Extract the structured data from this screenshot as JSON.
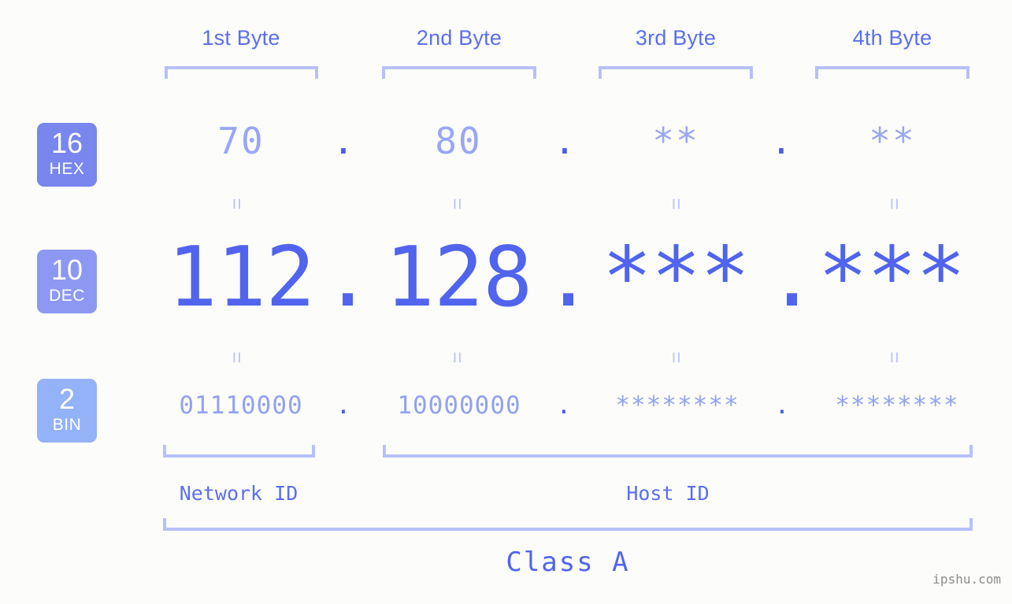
{
  "meta": {
    "watermark": "ipshu.com",
    "background_color": "#fcfdfa",
    "accent_color": "#5064ee",
    "accent_light_color": "#b8c0fb"
  },
  "headers": {
    "bytes": [
      {
        "label": "1st Byte"
      },
      {
        "label": "2nd Byte"
      },
      {
        "label": "3rd Byte"
      },
      {
        "label": "4th Byte"
      }
    ]
  },
  "bases": [
    {
      "number": "16",
      "name": "HEX",
      "color": "#7886ee"
    },
    {
      "number": "10",
      "name": "DEC",
      "color": "#8d98f3"
    },
    {
      "number": "2",
      "name": "BIN",
      "color": "#93b2f7"
    }
  ],
  "separators": {
    "dot": ".",
    "equals": "="
  },
  "rows": {
    "hex": {
      "base_number": "16",
      "base_name": "HEX",
      "values": [
        "70",
        "80",
        "**",
        "**"
      ]
    },
    "dec": {
      "base_number": "10",
      "base_name": "DEC",
      "values": [
        "112",
        "128",
        "***",
        "***"
      ]
    },
    "bin": {
      "base_number": "2",
      "base_name": "BIN",
      "values": [
        "01110000",
        "10000000",
        "********",
        "********"
      ]
    }
  },
  "footer": {
    "network_id_label": "Network ID",
    "host_id_label": "Host ID",
    "class_label": "Class A"
  }
}
